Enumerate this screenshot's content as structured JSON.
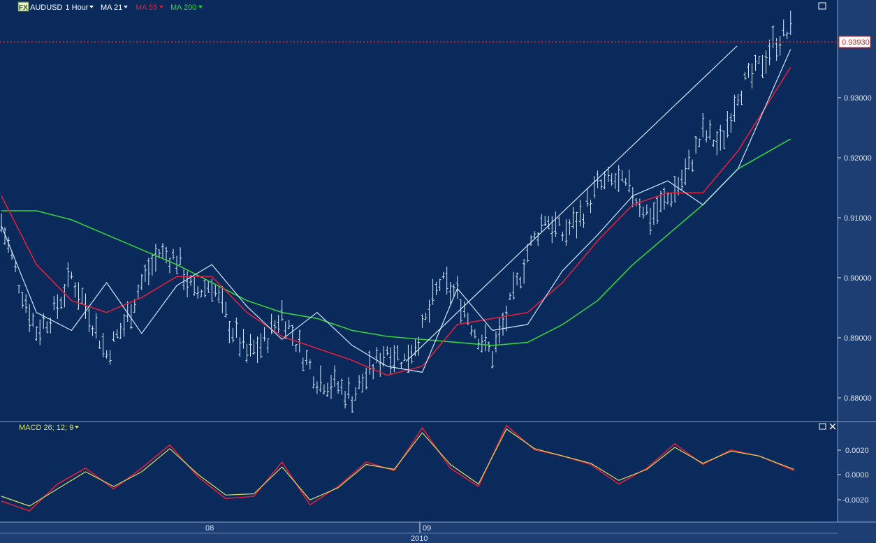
{
  "toolbar": {
    "fx_badge": "FX",
    "symbol": "AUDUSD",
    "timeframe": "1 Hour",
    "ma21_label": "MA 21",
    "ma55_label": "MA 55",
    "ma200_label": "MA 200",
    "ma21_color": "#cfe6ff",
    "ma55_color": "#e0203a",
    "ma200_color": "#36d23a"
  },
  "price_panel": {
    "current_price": "0.93930",
    "current_price_color": "#e0201a",
    "y_ticks": [
      "0.93000",
      "0.92000",
      "0.91000",
      "0.90000",
      "0.89000",
      "0.88000"
    ]
  },
  "macd_panel": {
    "label": "MACD 26; 12; 9",
    "y_ticks": [
      "0.0020",
      "0.0000",
      "-0.0020"
    ]
  },
  "time_axis": {
    "day_labels": [
      "08",
      "09"
    ],
    "year_label": "2010"
  },
  "colors": {
    "background": "#0a2a5c",
    "axis_bg": "#1d3e73",
    "bars": "#d6ecff",
    "trendline": "#d8e8ff",
    "macd_line": "#e0203a",
    "signal_line": "#d8e060"
  },
  "chart_data": [
    {
      "type": "line",
      "title": "AUDUSD 1 Hour",
      "series": [
        {
          "name": "MA 21",
          "x": [
            0,
            10,
            20,
            30,
            40,
            50,
            60,
            70,
            80,
            90,
            100,
            110,
            120,
            130,
            140,
            150,
            160,
            170,
            180,
            190,
            200,
            210,
            225
          ],
          "values": [
            0.9095,
            0.895,
            0.892,
            0.9,
            0.8915,
            0.8995,
            0.903,
            0.896,
            0.8905,
            0.895,
            0.8895,
            0.886,
            0.885,
            0.899,
            0.892,
            0.893,
            0.902,
            0.908,
            0.9145,
            0.917,
            0.913,
            0.919,
            0.939
          ]
        },
        {
          "name": "MA 55",
          "x": [
            0,
            10,
            20,
            30,
            40,
            50,
            60,
            70,
            80,
            90,
            100,
            110,
            120,
            130,
            140,
            150,
            160,
            170,
            180,
            190,
            200,
            210,
            225
          ],
          "values": [
            0.9145,
            0.903,
            0.897,
            0.895,
            0.8975,
            0.901,
            0.901,
            0.895,
            0.891,
            0.889,
            0.887,
            0.8845,
            0.886,
            0.893,
            0.894,
            0.895,
            0.9,
            0.907,
            0.913,
            0.915,
            0.915,
            0.922,
            0.936
          ]
        },
        {
          "name": "MA 200",
          "x": [
            0,
            10,
            20,
            30,
            40,
            50,
            60,
            70,
            80,
            90,
            100,
            110,
            120,
            130,
            140,
            150,
            160,
            170,
            180,
            190,
            200,
            210,
            225
          ],
          "values": [
            0.912,
            0.912,
            0.9105,
            0.908,
            0.9055,
            0.903,
            0.9,
            0.897,
            0.895,
            0.894,
            0.892,
            0.891,
            0.8905,
            0.89,
            0.8895,
            0.89,
            0.893,
            0.897,
            0.903,
            0.908,
            0.913,
            0.919,
            0.924
          ]
        },
        {
          "name": "Price",
          "x": [
            0,
            5,
            10,
            15,
            20,
            25,
            30,
            35,
            40,
            45,
            50,
            55,
            60,
            65,
            70,
            75,
            80,
            85,
            90,
            95,
            100,
            105,
            110,
            115,
            120,
            125,
            130,
            135,
            140,
            145,
            150,
            155,
            160,
            165,
            170,
            175,
            180,
            185,
            190,
            195,
            200,
            205,
            210,
            215,
            220,
            225
          ],
          "values": [
            0.91,
            0.9,
            0.892,
            0.895,
            0.901,
            0.895,
            0.888,
            0.893,
            0.9,
            0.905,
            0.904,
            0.898,
            0.9,
            0.893,
            0.888,
            0.89,
            0.895,
            0.889,
            0.884,
            0.883,
            0.881,
            0.885,
            0.889,
            0.887,
            0.892,
            0.9,
            0.898,
            0.892,
            0.888,
            0.896,
            0.905,
            0.911,
            0.908,
            0.911,
            0.916,
            0.917,
            0.915,
            0.911,
            0.914,
            0.918,
            0.925,
            0.923,
            0.932,
            0.935,
            0.94,
            0.942
          ]
        }
      ],
      "ylim": [
        0.877,
        0.947
      ],
      "xlim": [
        0,
        238
      ],
      "grid": false,
      "annotations": [
        "0.93930"
      ]
    },
    {
      "type": "line",
      "title": "MACD 26; 12; 9",
      "series": [
        {
          "name": "MACD",
          "x": [
            0,
            8,
            16,
            24,
            32,
            40,
            48,
            56,
            64,
            72,
            80,
            88,
            96,
            104,
            112,
            120,
            128,
            136,
            144,
            152,
            160,
            168,
            176,
            184,
            192,
            200,
            208,
            216,
            226
          ],
          "values": [
            -0.0022,
            -0.003,
            -0.0008,
            0.0005,
            -0.0012,
            0.0005,
            0.0024,
            -0.0002,
            -0.002,
            -0.0018,
            0.001,
            -0.0025,
            -0.001,
            0.001,
            0.0003,
            0.0038,
            0.0005,
            -0.001,
            0.004,
            0.002,
            0.0015,
            0.0008,
            -0.0008,
            0.0005,
            0.0025,
            0.0008,
            0.002,
            0.0015,
            0.0003
          ]
        },
        {
          "name": "Signal",
          "x": [
            0,
            8,
            16,
            24,
            32,
            40,
            48,
            56,
            64,
            72,
            80,
            88,
            96,
            104,
            112,
            120,
            128,
            136,
            144,
            152,
            160,
            168,
            176,
            184,
            192,
            200,
            208,
            216,
            226
          ],
          "values": [
            -0.0018,
            -0.0026,
            -0.0012,
            0.0002,
            -0.001,
            0.0002,
            0.0021,
            0.0,
            -0.0017,
            -0.0016,
            0.0006,
            -0.0021,
            -0.0011,
            0.0008,
            0.0004,
            0.0034,
            0.0008,
            -0.0008,
            0.0037,
            0.0021,
            0.0015,
            0.0009,
            -0.0005,
            0.0004,
            0.0022,
            0.0009,
            0.0019,
            0.0015,
            0.0004
          ]
        }
      ],
      "ylim": [
        -0.0038,
        0.0042
      ],
      "xlim": [
        0,
        238
      ],
      "grid": false
    }
  ]
}
